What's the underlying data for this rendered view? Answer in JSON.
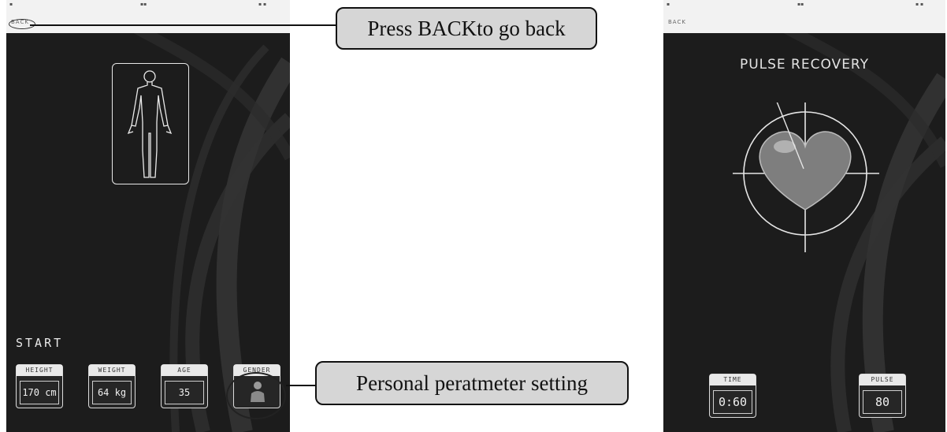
{
  "left_screen": {
    "back_label": "BACK",
    "start_label": "START",
    "tiles": [
      {
        "label": "HEIGHT",
        "value": "170 cm"
      },
      {
        "label": "WEIGHT",
        "value": "64 kg"
      },
      {
        "label": "AGE",
        "value": "35"
      },
      {
        "label": "GENDER",
        "value": ""
      }
    ]
  },
  "callouts": {
    "back": "Press BACKto go back",
    "personal": "Personal peratmeter setting"
  },
  "right_screen": {
    "back_label": "BACK",
    "title": "PULSE RECOVERY",
    "time_label": "TIME",
    "time_value": "0:60",
    "pulse_label": "PULSE",
    "pulse_value": "80"
  },
  "colors": {
    "screen_bg": "#1c1c1c",
    "status_bar": "#f2f2f2",
    "callout_bg": "#d6d6d6"
  }
}
